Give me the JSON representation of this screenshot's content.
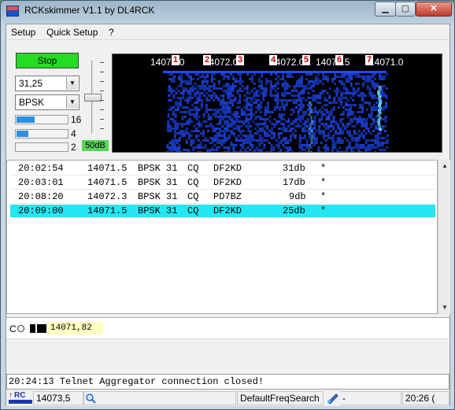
{
  "window": {
    "title": "RCKskimmer V1.1 by DL4RCK",
    "min_label": "▁",
    "max_label": "▢",
    "close_label": "✕"
  },
  "menu": [
    "Setup",
    "Quick Setup",
    "?"
  ],
  "controls": {
    "stop_label": "Stop",
    "speed_value": "31,25",
    "mode_value": "BPSK",
    "meters": [
      {
        "value": "16",
        "level": 0.35
      },
      {
        "value": "4",
        "level": 0.22
      },
      {
        "value": "2",
        "level": 0.0
      }
    ],
    "db_label": "50dB"
  },
  "waterfall": {
    "freq_labels": [
      "14071.0",
      "14072.0",
      "14072.0",
      "14071.5",
      "14071.0"
    ],
    "markers": [
      "1",
      "2",
      "3",
      "4",
      "5",
      "6",
      "7"
    ],
    "colors": {
      "background": "#000000",
      "signal": "#1e4bff",
      "hot": "#6ed0ff"
    }
  },
  "log": [
    {
      "time": "20:02:54",
      "freq": "14071.5",
      "mode": "BPSK 31",
      "type": "CQ",
      "call": "DF2KD",
      "snr": "31db",
      "flag": "*"
    },
    {
      "time": "20:03:01",
      "freq": "14071.5",
      "mode": "BPSK 31",
      "type": "CQ",
      "call": "DF2KD",
      "snr": "17db",
      "flag": "*"
    },
    {
      "time": "20:08:20",
      "freq": "14072.3",
      "mode": "BPSK 31",
      "type": "CQ",
      "call": "PD7BZ",
      "snr": "9db",
      "flag": "*"
    },
    {
      "time": "20:09:00",
      "freq": "14071.5",
      "mode": "BPSK 31",
      "type": "CQ",
      "call": "DF2KD",
      "snr": "25db",
      "flag": "*"
    }
  ],
  "cq": {
    "c_label": "C",
    "freq": "14071,82"
  },
  "status_message": "20:24:13 Telnet Aggregator connection closed!",
  "statusbar": {
    "freq": "14073,5",
    "search_mode": "DefaultFreqSearch",
    "net": "-",
    "time": "20:26 ("
  }
}
